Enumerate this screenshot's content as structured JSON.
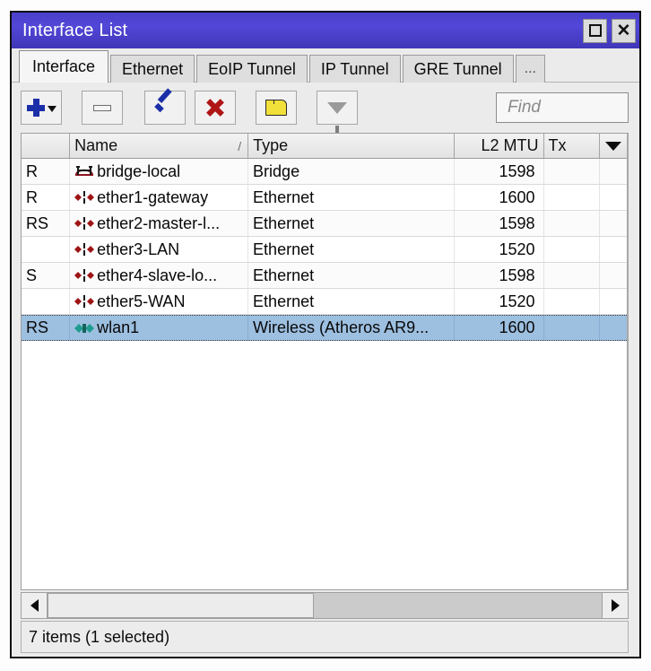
{
  "window": {
    "title": "Interface List",
    "maximize_label": "Maximize",
    "close_label": "Close"
  },
  "tabs": [
    {
      "label": "Interface",
      "active": true
    },
    {
      "label": "Ethernet",
      "active": false
    },
    {
      "label": "EoIP Tunnel",
      "active": false
    },
    {
      "label": "IP Tunnel",
      "active": false
    },
    {
      "label": "GRE Tunnel",
      "active": false
    },
    {
      "label": "...",
      "active": false
    }
  ],
  "toolbar": {
    "add_label": "Add",
    "add_icon": "plus-icon",
    "add_dropdown_icon": "chevron-down-icon",
    "remove_label": "Remove",
    "remove_icon": "minus-icon",
    "enable_label": "Enable",
    "enable_icon": "check-icon",
    "disable_label": "Disable",
    "disable_icon": "cross-icon",
    "comment_label": "Comment",
    "comment_icon": "tag-icon",
    "filter_label": "Filter",
    "filter_icon": "funnel-icon"
  },
  "search": {
    "placeholder": "Find",
    "value": "",
    "icon": "find-icon"
  },
  "table": {
    "columns": [
      {
        "key": "flags",
        "label": ""
      },
      {
        "key": "name",
        "label": "Name",
        "sort_indicator": "/"
      },
      {
        "key": "type",
        "label": "Type"
      },
      {
        "key": "l2mtu",
        "label": "L2 MTU"
      },
      {
        "key": "tx",
        "label": "Tx"
      }
    ],
    "column_menu_icon": "caret-down-icon",
    "rows": [
      {
        "flags": "R",
        "icon": "bridge-icon",
        "name": "bridge-local",
        "type": "Bridge",
        "l2mtu": "1598",
        "tx": "",
        "selected": false
      },
      {
        "flags": "R",
        "icon": "ethernet-icon",
        "name": "ether1-gateway",
        "type": "Ethernet",
        "l2mtu": "1600",
        "tx": "",
        "selected": false
      },
      {
        "flags": "RS",
        "icon": "ethernet-icon",
        "name": "ether2-master-l...",
        "type": "Ethernet",
        "l2mtu": "1598",
        "tx": "",
        "selected": false
      },
      {
        "flags": "",
        "icon": "ethernet-icon",
        "name": "ether3-LAN",
        "type": "Ethernet",
        "l2mtu": "1520",
        "tx": "",
        "selected": false
      },
      {
        "flags": "S",
        "icon": "ethernet-icon",
        "name": "ether4-slave-lo...",
        "type": "Ethernet",
        "l2mtu": "1598",
        "tx": "",
        "selected": false
      },
      {
        "flags": "",
        "icon": "ethernet-icon",
        "name": "ether5-WAN",
        "type": "Ethernet",
        "l2mtu": "1520",
        "tx": "",
        "selected": false
      },
      {
        "flags": "RS",
        "icon": "wireless-icon",
        "name": "wlan1",
        "type": "Wireless (Atheros AR9...",
        "l2mtu": "1600",
        "tx": "",
        "selected": true
      }
    ]
  },
  "scrollbar": {
    "left_arrow_icon": "arrow-left-icon",
    "right_arrow_icon": "arrow-right-icon",
    "thumb_position_pct": 0,
    "thumb_width_pct": 48
  },
  "status": {
    "text": "7 items (1 selected)"
  },
  "colors": {
    "titlebar": "#4a3fc9",
    "selection": "#9dbfe0",
    "window_bg": "#ebebeb",
    "icon_red": "#9e1414",
    "icon_blue": "#1b2fa8",
    "icon_teal": "#1f9c8f",
    "icon_yellow": "#f2e03a"
  }
}
